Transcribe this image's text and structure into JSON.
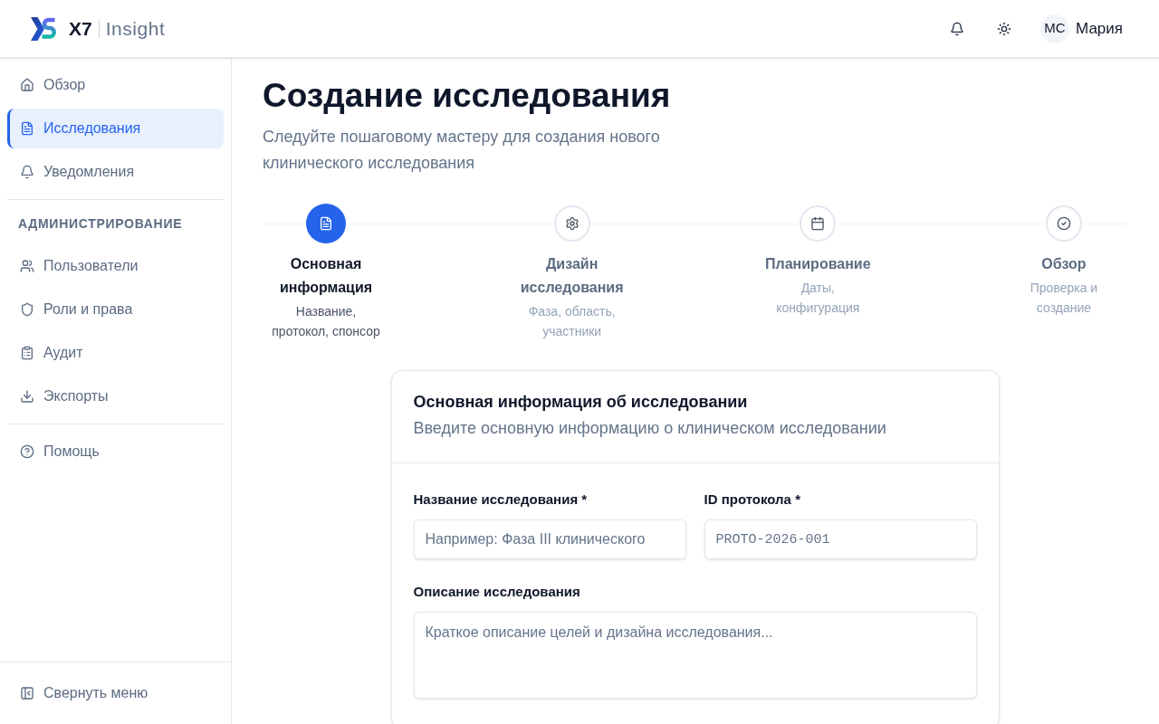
{
  "header": {
    "brand": {
      "name": "X7",
      "product": "Insight"
    },
    "user": {
      "initials": "МС",
      "name": "Мария"
    }
  },
  "sidebar": {
    "items": [
      {
        "label": "Обзор",
        "selected": false
      },
      {
        "label": "Исследования",
        "selected": true
      },
      {
        "label": "Уведомления",
        "selected": false
      }
    ],
    "admin_section": {
      "heading": "АДМИНИСТРИРОВАНИЕ",
      "items": [
        {
          "label": "Пользователи",
          "selected": false
        },
        {
          "label": "Роли и права",
          "selected": false
        },
        {
          "label": "Аудит",
          "selected": false
        },
        {
          "label": "Экспорты",
          "selected": false
        }
      ]
    },
    "help_items": [
      {
        "label": "Помощь",
        "selected": false
      }
    ],
    "collapse_button": {
      "label": "Свернуть меню"
    }
  },
  "page": {
    "title": "Создание исследования",
    "subtitle": "Следуйте пошаговому мастеру для создания нового клинического исследования"
  },
  "stepper": {
    "steps": [
      {
        "title": "Основная информация",
        "description": "Название, протокол, спонсор",
        "selected": true
      },
      {
        "title": "Дизайн исследования",
        "description": "Фаза, область, участники",
        "selected": false
      },
      {
        "title": "Планирование",
        "description": "Даты, конфигурация",
        "selected": false
      },
      {
        "title": "Обзор",
        "description": "Проверка и создание",
        "selected": false
      }
    ]
  },
  "form_card": {
    "title": "Основная информация об исследовании",
    "description": "Введите основную информацию о клиническом исследовании",
    "fields": [
      {
        "kind": "text",
        "label": "Название исследования *",
        "placeholder": "Например: Фаза III клинического"
      },
      {
        "kind": "code",
        "label": "ID протокола *",
        "placeholder": "PROTO-2026-001"
      },
      {
        "kind": "textarea",
        "label": "Описание исследования",
        "placeholder": "Краткое описание целей и дизайна исследования..."
      }
    ]
  }
}
